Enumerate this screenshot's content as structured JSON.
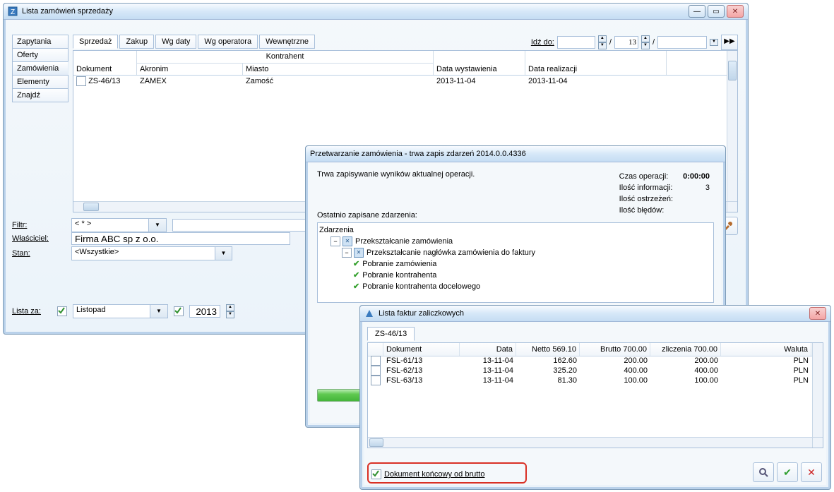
{
  "main": {
    "title": "Lista zamówień sprzedaży",
    "sidetabs": [
      "Zapytania",
      "Oferty",
      "Zamówienia",
      "Elementy",
      "Znajdź"
    ],
    "sidetab_sel": 2,
    "toptabs": [
      "Sprzedaż",
      "Zakup",
      "Wg daty",
      "Wg operatora",
      "Wewnętrzne"
    ],
    "toptab_sel": 0,
    "goto_label": "Idź do:",
    "goto_a": "",
    "goto_b": "13",
    "goto_c": "",
    "slash": "/",
    "cols": {
      "dokument": "Dokument",
      "kontrahent_group": "Kontrahent",
      "akronim": "Akronim",
      "miasto": "Miasto",
      "data_wyst": "Data wystawienia",
      "data_real": "Data realizacji"
    },
    "row": {
      "dokument": "ZS-46/13",
      "akronim": "ZAMEX",
      "miasto": "Zamość",
      "data_wyst": "2013-11-04",
      "data_real": "2013-11-04"
    },
    "filtr_label": "Filtr:",
    "filtr_val": "< * >",
    "wlasc_label": "Właściciel:",
    "wlasc_val": "Firma ABC sp z o.o.",
    "stan_label": "Stan:",
    "stan_val": "<Wszystkie>",
    "lista_label": "Lista za:",
    "miesiac": "Listopad",
    "rok": "2013"
  },
  "proc": {
    "title": "Przetwarzanie zamówienia - trwa zapis zdarzeń 2014.0.0.4336",
    "msg": "Trwa zapisywanie wyników aktualnej operacji.",
    "czas_label": "Czas operacji:",
    "czas_val": "0:00:00",
    "info_label": "Ilość informacji:",
    "info_val": "3",
    "warn_label": "Ilość ostrzeżeń:",
    "warn_val": "",
    "err_label": "Ilość błędów:",
    "err_val": "",
    "evttl": "Ostatnio zapisane zdarzenia:",
    "tree": {
      "root": "Zdarzenia",
      "n1": "Przekształcanie zamówienia",
      "n2": "Przekształcanie nagłówka zamówienia do faktury",
      "ok1": "Pobranie zamówienia",
      "ok2": "Pobranie kontrahenta",
      "ok3": "Pobranie kontrahenta docelowego"
    }
  },
  "inv": {
    "title": "Lista faktur zaliczkowych",
    "tab": "ZS-46/13",
    "cols": {
      "dokument": "Dokument",
      "data": "Data",
      "netto": "Netto 569.10",
      "brutto": "Brutto 700.00",
      "zlicz": "zliczenia 700.00",
      "waluta": "Waluta"
    },
    "rows": [
      {
        "dokument": "FSL-61/13",
        "data": "13-11-04",
        "netto": "162.60",
        "brutto": "200.00",
        "zlicz": "200.00",
        "waluta": "PLN"
      },
      {
        "dokument": "FSL-62/13",
        "data": "13-11-04",
        "netto": "325.20",
        "brutto": "400.00",
        "zlicz": "400.00",
        "waluta": "PLN"
      },
      {
        "dokument": "FSL-63/13",
        "data": "13-11-04",
        "netto": "81.30",
        "brutto": "100.00",
        "zlicz": "100.00",
        "waluta": "PLN"
      }
    ],
    "chk_label": "Dokument końcowy od brutto"
  }
}
